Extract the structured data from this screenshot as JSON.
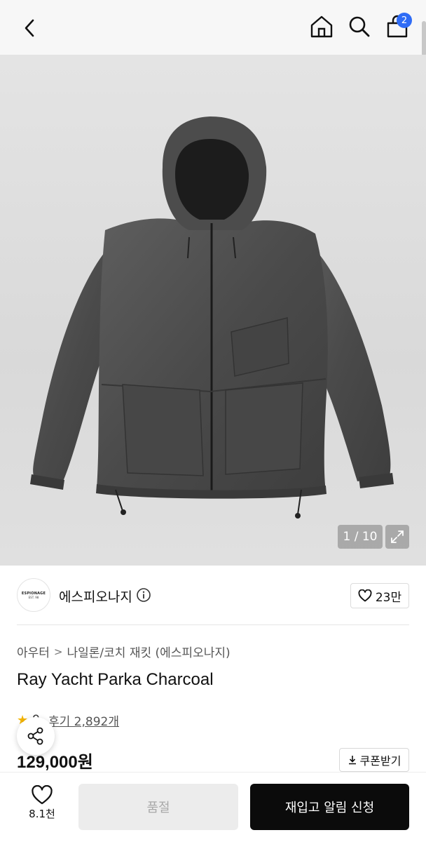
{
  "header": {
    "back_icon": "chevron-left-icon",
    "home_icon": "home-icon",
    "search_icon": "search-icon",
    "cart_icon": "shopping-bag-icon",
    "cart_badge": "2",
    "badge_color": "#2f6cf6"
  },
  "gallery": {
    "counter": "1 / 10",
    "expand_icon": "expand-icon"
  },
  "brand": {
    "logo_line1": "ESPIONAGE",
    "logo_line2": "EST. 98",
    "name": "에스피오나지",
    "info_icon": "info-icon",
    "likes": "23만"
  },
  "breadcrumb": {
    "items": [
      "아우터",
      "나일론/코치 재킷 (에스피오나지)"
    ],
    "separator": ">"
  },
  "product": {
    "title": "Ray Yacht Parka Charcoal",
    "rating_partial": "9",
    "reviews": "후기 2,892개",
    "price": "129,000원",
    "coupon": "쿠폰받기"
  },
  "bottom_bar": {
    "wish_count": "8.1천",
    "soldout_label": "품절",
    "restock_label": "재입고 알림 신청",
    "primary_color": "#0b0b0b"
  }
}
